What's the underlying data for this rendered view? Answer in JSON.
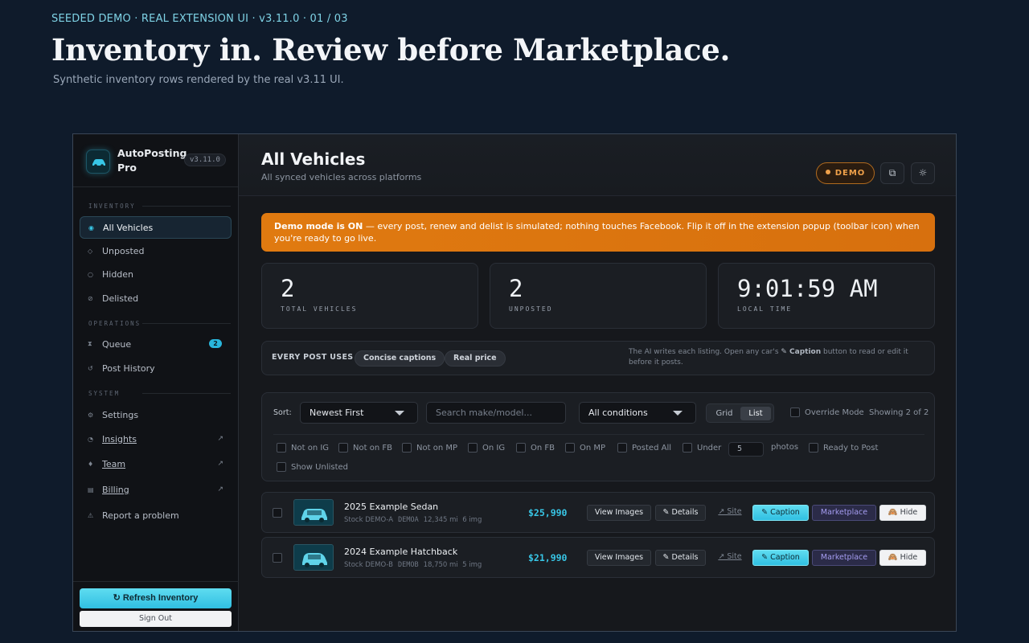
{
  "hero": {
    "eyebrow": "SEEDED DEMO · REAL EXTENSION UI · v3.11.0 · 01 / 03",
    "title": "Inventory in. Review before Marketplace.",
    "subtitle": "Synthetic inventory rows rendered by the real v3.11 UI."
  },
  "sidebar": {
    "app_name": "AutoPosting Pro",
    "version": "v3.11.0",
    "sections": {
      "inventory": "INVENTORY",
      "operations": "OPERATIONS",
      "system": "SYSTEM"
    },
    "inventory_items": [
      {
        "label": "All Vehicles",
        "icon": "dot-icon",
        "active": true
      },
      {
        "label": "Unposted",
        "icon": "diamond-icon"
      },
      {
        "label": "Hidden",
        "icon": "circle-icon"
      },
      {
        "label": "Delisted",
        "icon": "slash-circle-icon"
      }
    ],
    "operations_items": [
      {
        "label": "Queue",
        "icon": "hourglass-icon",
        "badge": "2"
      },
      {
        "label": "Post History",
        "icon": "history-icon"
      }
    ],
    "system_items": [
      {
        "label": "Settings",
        "icon": "gear-icon"
      },
      {
        "label": "Insights",
        "icon": "chart-icon",
        "external": true
      },
      {
        "label": "Team",
        "icon": "person-icon",
        "external": true
      },
      {
        "label": "Billing",
        "icon": "card-icon",
        "external": true
      },
      {
        "label": "Report a problem",
        "icon": "warning-icon"
      }
    ],
    "refresh_label": "↻ Refresh Inventory",
    "signout_label": "Sign Out"
  },
  "header": {
    "title": "All Vehicles",
    "subtitle": "All synced vehicles across platforms",
    "demo_badge": "DEMO"
  },
  "banner": {
    "bold": "Demo mode is ON",
    "text": " — every post, renew and delist is simulated; nothing touches Facebook. Flip it off in the extension popup (toolbar icon) when you're ready to go live."
  },
  "stats": [
    {
      "value": "2",
      "label": "TOTAL VEHICLES"
    },
    {
      "value": "2",
      "label": "UNPOSTED"
    },
    {
      "value": "9:01:59 AM",
      "label": "LOCAL TIME"
    }
  ],
  "preferences": {
    "label": "EVERY POST USES",
    "chips": [
      "Concise captions",
      "Real price"
    ],
    "note_a": "The AI writes each listing. Open any car's ",
    "note_b": "✎ Caption",
    "note_c": " button to read or edit it before it posts."
  },
  "filters": {
    "sort_label": "Sort:",
    "sort_value": "Newest First",
    "search_placeholder": "Search make/model...",
    "condition_value": "All conditions",
    "view_grid": "Grid",
    "view_list": "List",
    "override_label": "Override Mode",
    "showing": "Showing 2 of 2",
    "checks": [
      "Not on IG",
      "Not on FB",
      "Not on MP",
      "On IG",
      "On FB",
      "On MP",
      "Posted All"
    ],
    "under_label": "Under",
    "under_value": "5",
    "photos_label": "photos",
    "ready_label": "Ready to Post",
    "unlisted_label": "Show Unlisted"
  },
  "vehicles": [
    {
      "title": "2025 Example Sedan",
      "stock": "Stock DEMO-A",
      "code": "DEMOA",
      "miles": "12,345 mi",
      "imgs": "6 img",
      "price": "$25,990"
    },
    {
      "title": "2024 Example Hatchback",
      "stock": "Stock DEMO-B",
      "code": "DEMOB",
      "miles": "18,750 mi",
      "imgs": "5 img",
      "price": "$21,990"
    }
  ],
  "row_actions": {
    "view_images": "View Images",
    "details": "✎ Details",
    "site": "↗ Site",
    "caption": "✎ Caption",
    "marketplace": "Marketplace",
    "hide": "🙈 Hide"
  },
  "colors": {
    "accent": "#38c6e6",
    "warning": "#e07a10",
    "marketplace": "#a49cf0"
  }
}
